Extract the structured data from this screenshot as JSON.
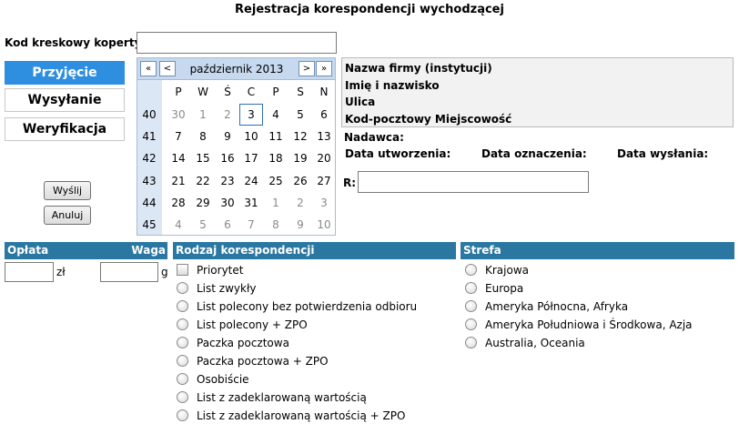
{
  "title": "Rejestracja korespondencji wychodzącej",
  "barcode": {
    "label": "Kod kreskowy koperty",
    "value": ""
  },
  "nav": {
    "active": "Przyjęcie",
    "items": [
      "Przyjęcie",
      "Wysyłanie",
      "Weryfikacja"
    ]
  },
  "actions": {
    "send": "Wyślij",
    "cancel": "Anuluj"
  },
  "calendar": {
    "month": "październik 2013",
    "nav": {
      "prev_year": "«",
      "prev_month": "<",
      "next_month": ">",
      "next_year": "»"
    },
    "days_of_week": [
      "P",
      "W",
      "Ś",
      "C",
      "P",
      "S",
      "N"
    ],
    "selected_day": "3",
    "weeks": [
      {
        "week": "40",
        "days": [
          "30",
          "1",
          "2",
          "3",
          "4",
          "5",
          "6"
        ]
      },
      {
        "week": "41",
        "days": [
          "7",
          "8",
          "9",
          "10",
          "11",
          "12",
          "13"
        ]
      },
      {
        "week": "42",
        "days": [
          "14",
          "15",
          "16",
          "17",
          "18",
          "19",
          "20"
        ]
      },
      {
        "week": "43",
        "days": [
          "21",
          "22",
          "23",
          "24",
          "25",
          "26",
          "27"
        ]
      },
      {
        "week": "44",
        "days": [
          "28",
          "29",
          "30",
          "31",
          "1",
          "2",
          "3"
        ]
      },
      {
        "week": "45",
        "days": [
          "4",
          "5",
          "6",
          "7",
          "8",
          "9",
          "10"
        ]
      }
    ],
    "other_month": [
      [
        1,
        1,
        1,
        0,
        0,
        0,
        0
      ],
      [
        0,
        0,
        0,
        0,
        0,
        0,
        0
      ],
      [
        0,
        0,
        0,
        0,
        0,
        0,
        0
      ],
      [
        0,
        0,
        0,
        0,
        0,
        0,
        0
      ],
      [
        0,
        0,
        0,
        0,
        1,
        1,
        1
      ],
      [
        1,
        1,
        1,
        1,
        1,
        1,
        1
      ]
    ]
  },
  "recipient": {
    "company": "Nazwa firmy (instytucji)",
    "name": "Imię i nazwisko",
    "street": "Ulica",
    "postal_city": "Kod-pocztowy Miejscowość"
  },
  "meta": {
    "sender": "Nadawca:",
    "created": "Data utworzenia:",
    "marked": "Data oznaczenia:",
    "sent": "Data wysłania:",
    "r_label": "R:",
    "r_value": ""
  },
  "fees": {
    "header_fee": "Opłata",
    "header_weight": "Waga",
    "fee_value": "",
    "fee_unit": "zł",
    "weight_value": "",
    "weight_unit": "g"
  },
  "kind": {
    "header": "Rodzaj korespondencji",
    "priority": "Priorytet",
    "options": [
      "List zwykły",
      "List polecony bez potwierdzenia odbioru",
      "List polecony + ZPO",
      "Paczka pocztowa",
      "Paczka pocztowa + ZPO",
      "Osobiście",
      "List z zadeklarowaną wartością",
      "List z zadeklarowaną wartością + ZPO"
    ]
  },
  "zone": {
    "header": "Strefa",
    "options": [
      "Krajowa",
      "Europa",
      "Ameryka Północna, Afryka",
      "Ameryka Południowa i Środkowa, Azja",
      "Australia, Oceania"
    ]
  }
}
